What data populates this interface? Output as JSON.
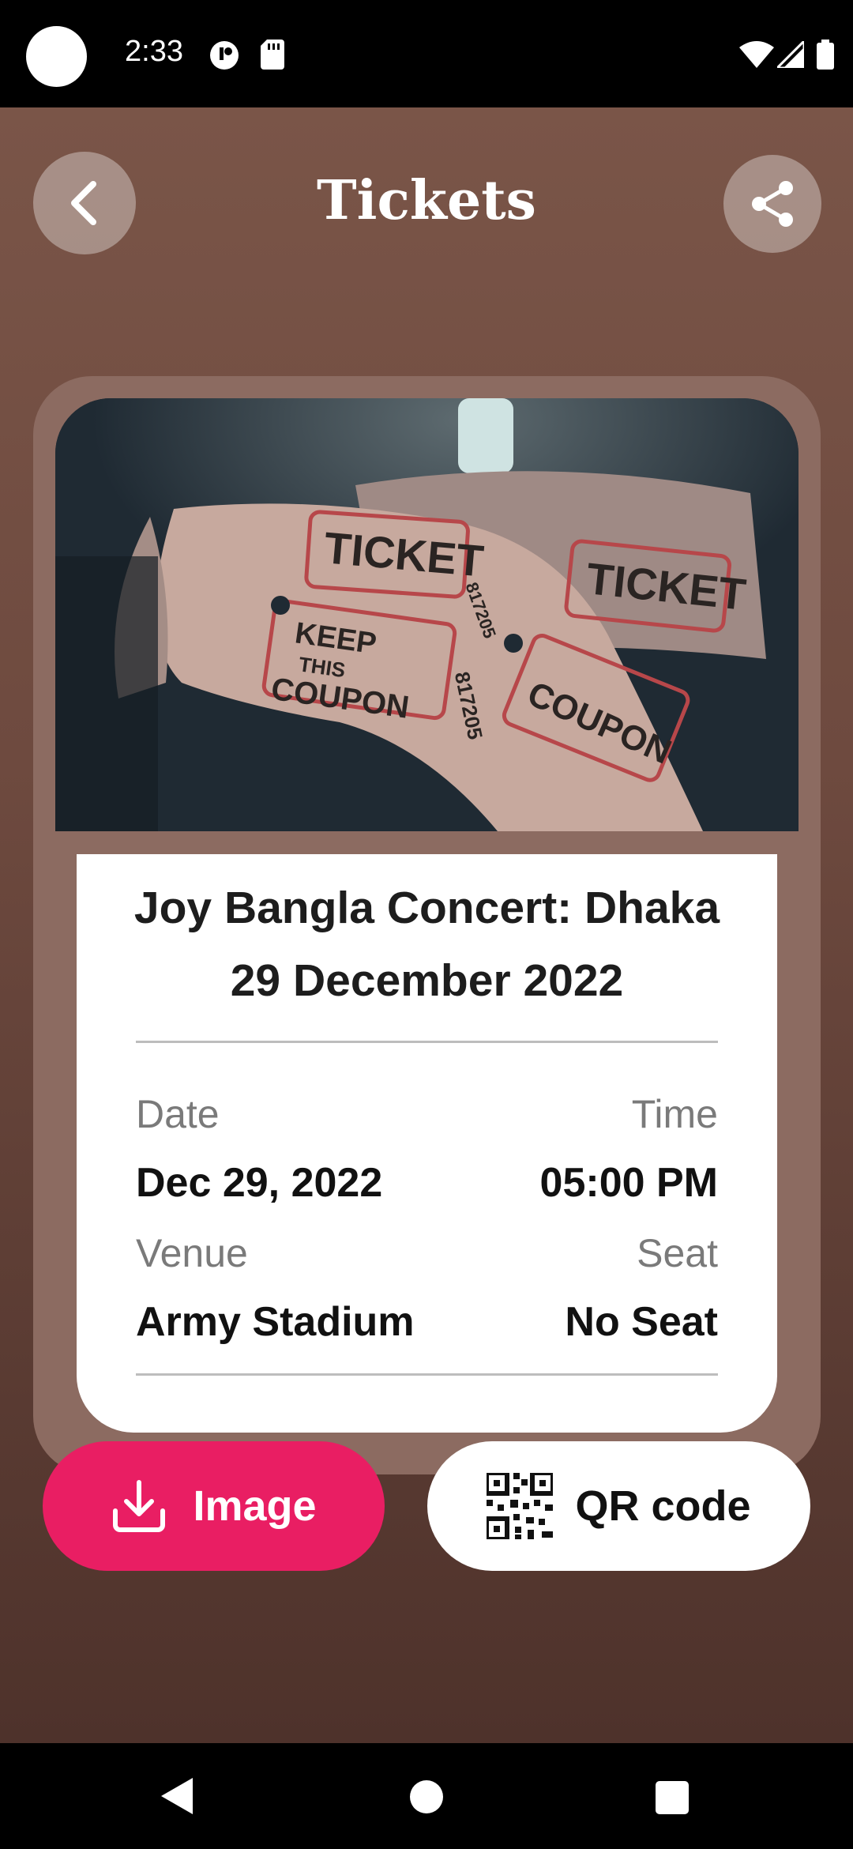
{
  "status_bar": {
    "time": "2:33"
  },
  "header": {
    "title": "Tickets",
    "back_icon": "chevron-left-icon",
    "share_icon": "share-icon"
  },
  "event": {
    "title_line1": "Joy Bangla Concert: Dhaka",
    "title_line2": "29 December 2022",
    "image_text": [
      "TICKET",
      "KEEP THIS COUPON",
      "817205"
    ]
  },
  "details": {
    "date_label": "Date",
    "date_value": "Dec 29, 2022",
    "time_label": "Time",
    "time_value": "05:00 PM",
    "venue_label": "Venue",
    "venue_value": "Army Stadium",
    "seat_label": "Seat",
    "seat_value": "No Seat"
  },
  "actions": {
    "image_label": "Image",
    "qr_label": "QR code"
  },
  "colors": {
    "accent": "#e91e63",
    "background_top": "#7a5548",
    "background_bottom": "#4e322b",
    "card": "#8c6b61"
  }
}
